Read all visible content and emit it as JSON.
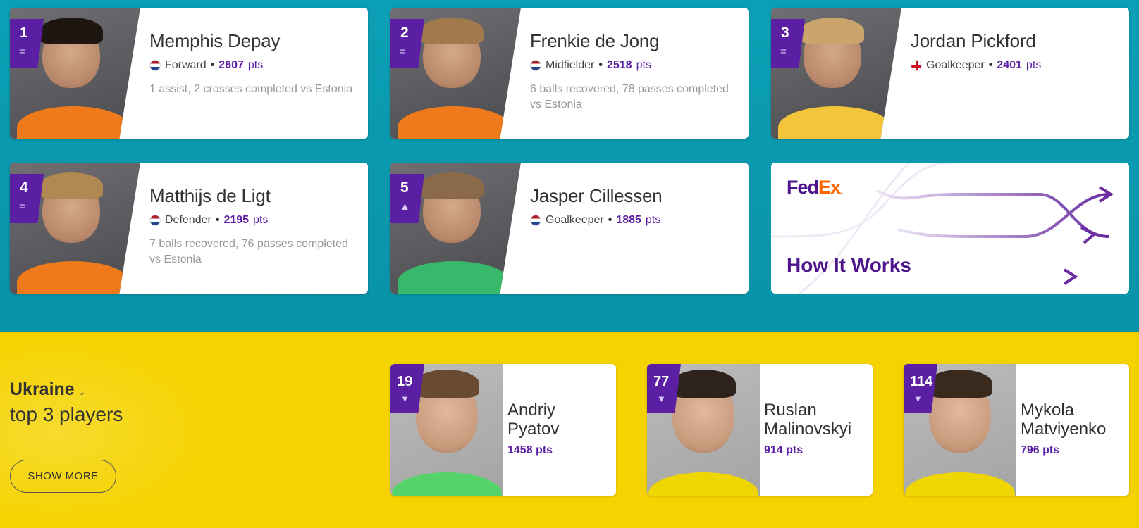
{
  "top_players": [
    {
      "rank": "1",
      "trend": "=",
      "name": "Memphis Depay",
      "position": "Forward",
      "points": "2607",
      "pts_unit": "pts",
      "description": "1 assist, 2 crosses completed vs Estonia",
      "flag": "nl"
    },
    {
      "rank": "2",
      "trend": "=",
      "name": "Frenkie de Jong",
      "position": "Midfielder",
      "points": "2518",
      "pts_unit": "pts",
      "description": "6 balls recovered, 78 passes completed vs Estonia",
      "flag": "nl"
    },
    {
      "rank": "3",
      "trend": "=",
      "name": "Jordan Pickford",
      "position": "Goalkeeper",
      "points": "2401",
      "pts_unit": "pts",
      "description": "",
      "flag": "en"
    },
    {
      "rank": "4",
      "trend": "=",
      "name": "Matthijs de Ligt",
      "position": "Defender",
      "points": "2195",
      "pts_unit": "pts",
      "description": "7 balls recovered, 76 passes completed vs Estonia",
      "flag": "nl"
    },
    {
      "rank": "5",
      "trend": "▲",
      "name": "Jasper Cillessen",
      "position": "Goalkeeper",
      "points": "1885",
      "pts_unit": "pts",
      "description": "",
      "flag": "nl"
    }
  ],
  "sponsor": {
    "logo_fed": "Fed",
    "logo_ex": "Ex",
    "logo_mark": ".",
    "cta": "How It Works"
  },
  "team_section": {
    "team": "Ukraine",
    "chevron": "⌄",
    "subtitle": "top 3 players",
    "show_more": "SHOW MORE",
    "players": [
      {
        "rank": "19",
        "trend": "▼",
        "name_line1": "Andriy",
        "name_line2": "Pyatov",
        "points": "1458 pts"
      },
      {
        "rank": "77",
        "trend": "▼",
        "name_line1": "Ruslan",
        "name_line2": "Malinovskyi",
        "points": "914 pts"
      },
      {
        "rank": "114",
        "trend": "▼",
        "name_line1": "Mykola",
        "name_line2": "Matviyenko",
        "points": "796 pts"
      }
    ]
  },
  "colors": {
    "teal": "#0a9fb3",
    "purple": "#5b1fa3",
    "yellow": "#f5d300",
    "fedex_purple": "#4d148c",
    "fedex_orange": "#ff6600"
  }
}
